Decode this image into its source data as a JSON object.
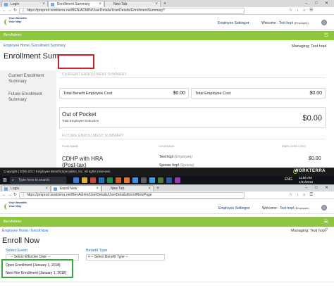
{
  "window1": {
    "tabs": [
      {
        "label": "Login"
      },
      {
        "label": "Enrollment Summary"
      },
      {
        "label": "New Tab"
      }
    ],
    "url": "https://preprod.workterra.net/BEN/ADMIN/UserDetails/UserDetails/EnrollmentSummary?",
    "logo_text": "Your Benefits Your Way",
    "employee_settings": "Employee Settings",
    "welcome_label": "Welcome :",
    "welcome_user": "Test hopl",
    "welcome_role": "(Employee)",
    "green_bar_label": "BenAdmin",
    "breadcrumb": [
      "Employee Home",
      "Enrollment Summary"
    ],
    "managing": "Managing: Test hopl",
    "page_title": "Enrollment Summary",
    "current_label": "Current Enrollment Summary",
    "future_label": "Future Enrollment Summary",
    "current_section_header": "CURRENT ENROLLMENT SUMMARY",
    "rows": [
      {
        "label": "Total Benefit Employee Cost",
        "amount": "$0.00"
      },
      {
        "label": "Total Employee Cost",
        "amount": "$0.00"
      }
    ],
    "out_of_pocket": "Out of Pocket",
    "total_deduction_label": "Total Employee Deduction",
    "oop_amount": "$0.00",
    "future_section_header": "FUTURE ENROLLMENT SUMMARY",
    "col_plan": "PLAN NAME",
    "col_coverage": "COVERAGE",
    "col_cost": "EMPLOYEE COST",
    "plan_name": "CDHP with HRA (Post-tax)",
    "coverage": [
      {
        "name": "Test hopl",
        "role": "(Employee)"
      },
      {
        "name": "Spouse hopl",
        "role": "(Spouse)"
      }
    ],
    "plan_amount": "$0.00",
    "footer_copyright": "Copyright | 2006-2017 Employee Benefit Specialists, Inc. All rights reserved.",
    "footer_brand": "WORKTERRA",
    "taskbar_search": "Type here to search",
    "tray_lang": "ENG",
    "tray_time": "11:56 AM",
    "tray_date": "1/31/2018"
  },
  "window2": {
    "tabs": [
      {
        "label": "Login"
      },
      {
        "label": "Enroll Now"
      },
      {
        "label": "New Tab"
      }
    ],
    "url": "https://preprod.workterra.net/BenAdmin/UserDetails/UserDetails/EnrollNowPage",
    "logo_text": "Your Benefits Your Way",
    "employee_settings": "Employee Settings",
    "welcome_label": "Welcome :",
    "welcome_user": "Test hopl",
    "welcome_role": "(Employee)",
    "green_bar_label": "BenAdmin",
    "breadcrumb": [
      "Employee Home",
      "Enroll Now"
    ],
    "managing": "Managing: Test hopl",
    "page_title": "Enroll Now",
    "select_event_label": "Select Event",
    "select_event_value": "-- Select Effective Date --",
    "benefit_type_label": "Benefit Type",
    "benefit_type_value": "-- Select Benefit Type --",
    "dropdown_options": [
      {
        "label": "Open Enrollment [January 1, 2018]"
      },
      {
        "label": "New Hire Enrollment [January 1, 2018]"
      }
    ]
  },
  "colors": {
    "green_bar": "#8dc63f",
    "red_highlight": "#c8232c",
    "green_highlight": "#35a83c",
    "link_blue": "#1f6fbf"
  }
}
